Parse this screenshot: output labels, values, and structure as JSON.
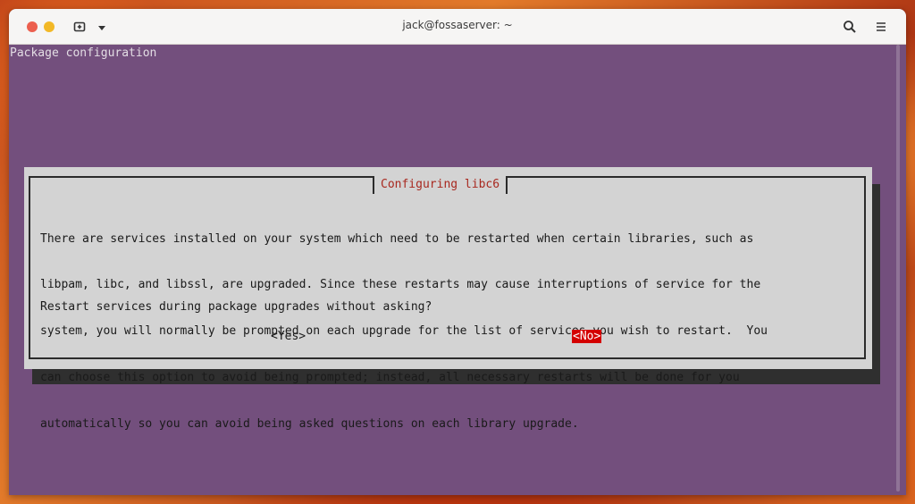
{
  "window": {
    "title": "jack@fossaserver: ~"
  },
  "titlebar": {
    "close_icon": "close-dot",
    "minimize_icon": "minimize-dot",
    "new_tab_icon": "new-tab-icon",
    "dropdown_icon": "chevron-down-icon",
    "search_icon": "search-icon",
    "menu_icon": "hamburger-menu-icon"
  },
  "terminal": {
    "header": "Package configuration",
    "dialog": {
      "title": "Configuring libc6",
      "body_lines": [
        "There are services installed on your system which need to be restarted when certain libraries, such as",
        "libpam, libc, and libssl, are upgraded. Since these restarts may cause interruptions of service for the",
        "system, you will normally be prompted on each upgrade for the list of services you wish to restart.  You",
        "can choose this option to avoid being prompted; instead, all necessary restarts will be done for you",
        "automatically so you can avoid being asked questions on each library upgrade."
      ],
      "question": "Restart services during package upgrades without asking?",
      "yes_label": "<Yes>",
      "no_label": "<No>",
      "selected": "no"
    }
  },
  "colors": {
    "terminal_bg": "#734f7d",
    "dialog_bg": "#d3d3d3",
    "dialog_title": "#a8281f",
    "selected_button_bg": "#d40000",
    "titlebar_bg": "#f6f5f4"
  }
}
